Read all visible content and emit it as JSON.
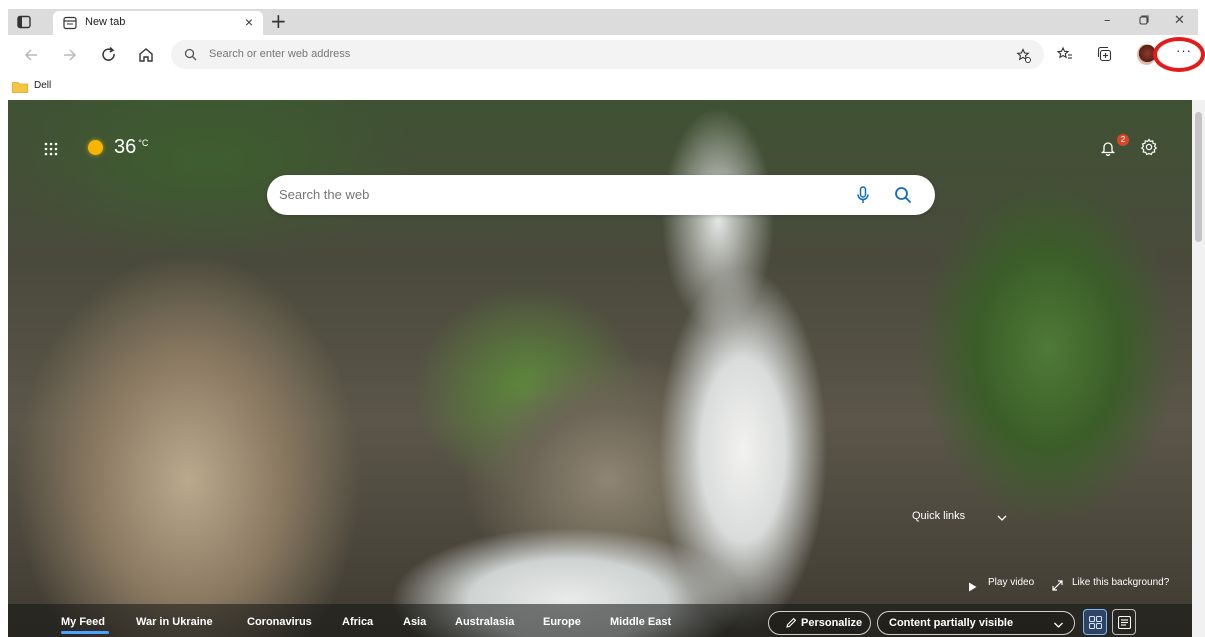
{
  "browser": {
    "tab_title": "New tab",
    "tab_close": "×",
    "new_tab": "+",
    "window_controls": {
      "minimize": "–",
      "restore": "▫",
      "close": "✕"
    },
    "address_placeholder": "Search or enter web address",
    "more_label": "···",
    "highlight_color": "#e41b1b"
  },
  "favorites": [
    {
      "label": "Dell",
      "icon": "folder-icon"
    }
  ],
  "newtab": {
    "weather": {
      "temp": "36",
      "unit": "°C",
      "icon": "sun-icon"
    },
    "notifications": {
      "count": "2"
    },
    "search": {
      "placeholder": "Search the web"
    },
    "quick_links": "Quick links",
    "play_video": "Play video",
    "like_background": "Like this background?"
  },
  "feed": {
    "tabs": [
      "My Feed",
      "War in Ukraine",
      "Coronavirus",
      "Africa",
      "Asia",
      "Australasia",
      "Europe",
      "Middle East"
    ],
    "active_tab": "My Feed",
    "personalize": "Personalize",
    "content_visibility": "Content partially visible",
    "accent": "#4ea1ff"
  }
}
